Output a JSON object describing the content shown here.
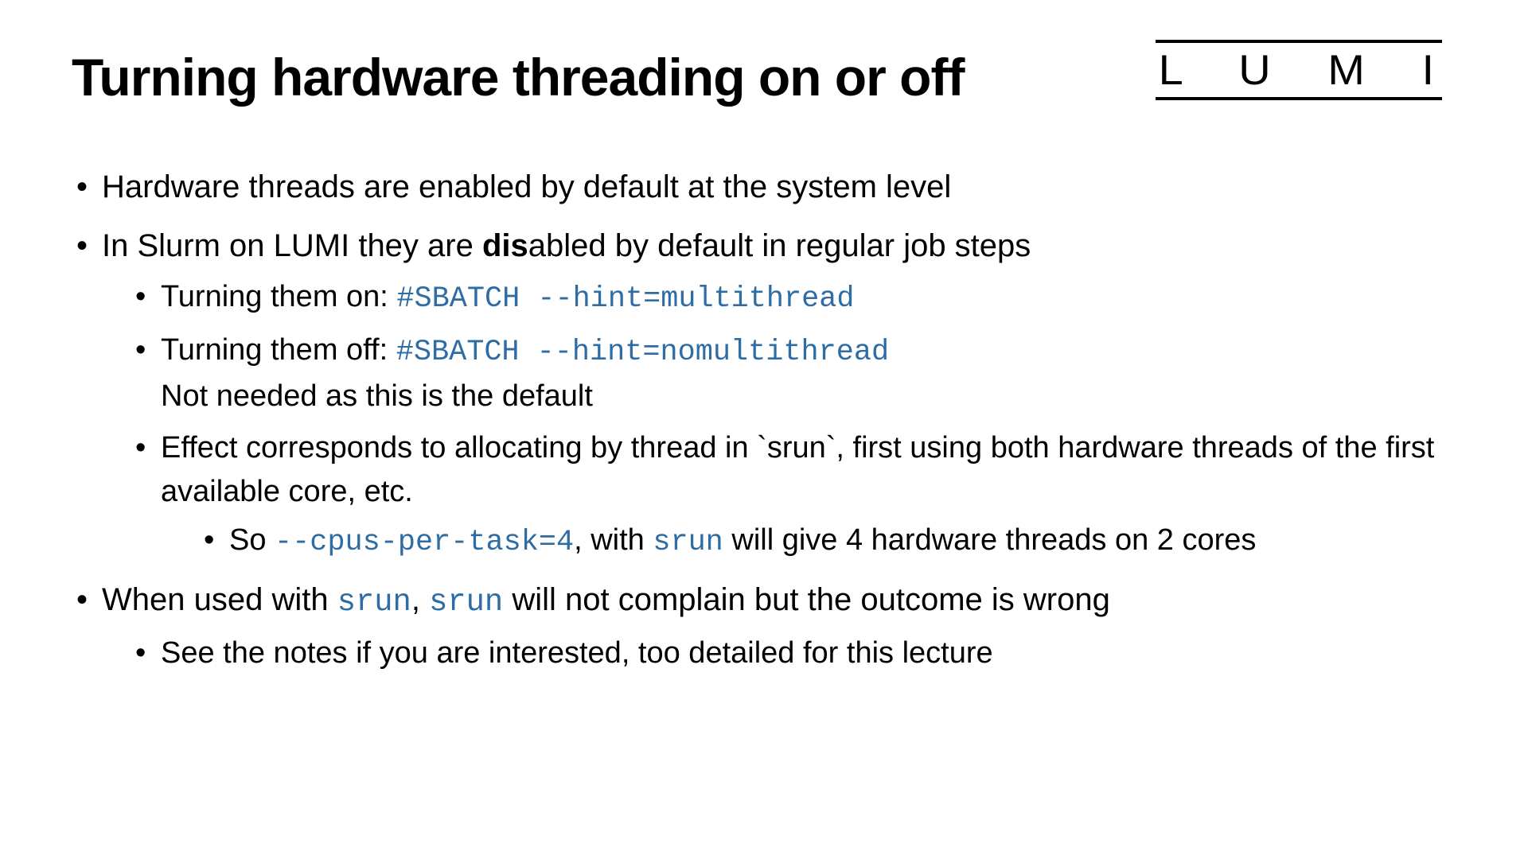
{
  "logo": "L U M I",
  "title": "Turning hardware threading on or off",
  "code_color": "#2e6ca4",
  "b1_a": "Hardware threads are enabled by default at the system level",
  "b1_b_pre": "In Slurm on LUMI they are ",
  "b1_b_bold": "dis",
  "b1_b_post": "abled by default in regular job steps",
  "b2_a_pre": "Turning them on: ",
  "b2_a_code": "#SBATCH --hint=multithread",
  "b2_b_pre": "Turning them off: ",
  "b2_b_code": "#SBATCH --hint=nomultithread",
  "b2_b_note": "Not needed as this is the default",
  "b2_c": "Effect corresponds to allocating by thread in `srun`, first using both hardware threads of the first available core, etc.",
  "b3_a_pre": "So ",
  "b3_a_code1": "--cpus-per-task=4",
  "b3_a_mid": ", with ",
  "b3_a_code2": "srun",
  "b3_a_post": " will give 4 hardware threads on 2 cores",
  "b1_c_pre": "When used with ",
  "b1_c_code1": "srun",
  "b1_c_mid": ", ",
  "b1_c_code2": "srun",
  "b1_c_post": " will not complain but the outcome is wrong",
  "b2_d": "See the notes if you are interested, too detailed for this lecture"
}
